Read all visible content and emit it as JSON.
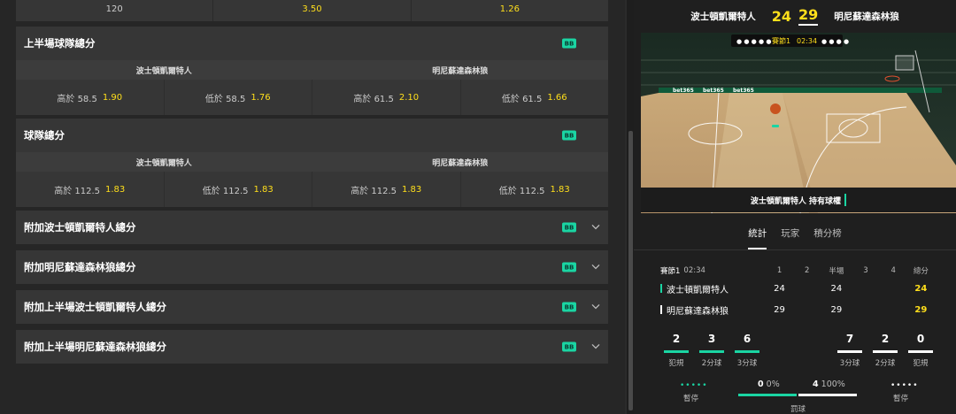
{
  "top_row": {
    "c1": "120",
    "c2": "3.50",
    "c3": "1.26"
  },
  "markets": {
    "first_half_team_totals": {
      "title": "上半場球隊總分",
      "badge": "BB",
      "teams": [
        "波士頓凱爾特人",
        "明尼蘇達森林狼"
      ],
      "odds": [
        {
          "label": "高於 58.5",
          "price": "1.90"
        },
        {
          "label": "低於 58.5",
          "price": "1.76"
        },
        {
          "label": "高於 61.5",
          "price": "2.10"
        },
        {
          "label": "低於 61.5",
          "price": "1.66"
        }
      ]
    },
    "team_totals": {
      "title": "球隊總分",
      "badge": "BB",
      "teams": [
        "波士頓凱爾特人",
        "明尼蘇達森林狼"
      ],
      "odds": [
        {
          "label": "高於 112.5",
          "price": "1.83"
        },
        {
          "label": "低於 112.5",
          "price": "1.83"
        },
        {
          "label": "高於 112.5",
          "price": "1.83"
        },
        {
          "label": "低於 112.5",
          "price": "1.83"
        }
      ]
    },
    "collapsed": [
      {
        "title": "附加波士頓凱爾特人總分",
        "badge": "BB"
      },
      {
        "title": "附加明尼蘇達森林狼總分",
        "badge": "BB"
      },
      {
        "title": "附加上半場波士頓凱爾特人總分",
        "badge": "BB"
      },
      {
        "title": "附加上半場明尼蘇達森林狼總分",
        "badge": "BB"
      }
    ]
  },
  "scoreboard": {
    "home": "波士頓凱爾特人",
    "away": "明尼蘇達森林狼",
    "home_score": "24",
    "away_score": "29",
    "period_label": "賽節1",
    "clock": "02:34",
    "possession": "波士頓凱爾特人  持有球權",
    "court_ads": [
      "bet365",
      "bet365",
      "bet365"
    ]
  },
  "tabs": [
    "統計",
    "玩家",
    "積分榜"
  ],
  "stats": {
    "period": "賽節1",
    "clock": "02:34",
    "headers": [
      "1",
      "2",
      "半場",
      "3",
      "4",
      "總分"
    ],
    "rows": [
      {
        "team": "波士頓凱爾特人",
        "q1": "24",
        "q2": "",
        "half": "24",
        "q3": "",
        "q4": "",
        "total": "24",
        "color": "#1ad5a3"
      },
      {
        "team": "明尼蘇達森林狼",
        "q1": "29",
        "q2": "",
        "half": "29",
        "q3": "",
        "q4": "",
        "total": "29",
        "color": "#ffffff"
      }
    ]
  },
  "counters_left": [
    {
      "n": "2",
      "label": "犯規"
    },
    {
      "n": "3",
      "label": "2分球"
    },
    {
      "n": "6",
      "label": "3分球"
    }
  ],
  "counters_right": [
    {
      "n": "7",
      "label": "3分球"
    },
    {
      "n": "2",
      "label": "2分球"
    },
    {
      "n": "0",
      "label": "犯規"
    }
  ],
  "bottom": {
    "left_label": "暫停",
    "right_label": "暫停",
    "fouls_label": "罰球",
    "left_n": "0",
    "left_pct": "0%",
    "right_n": "4",
    "right_pct": "100%"
  },
  "colors": {
    "accent": "#1ad5a3",
    "odds": "#ffdf1b"
  }
}
